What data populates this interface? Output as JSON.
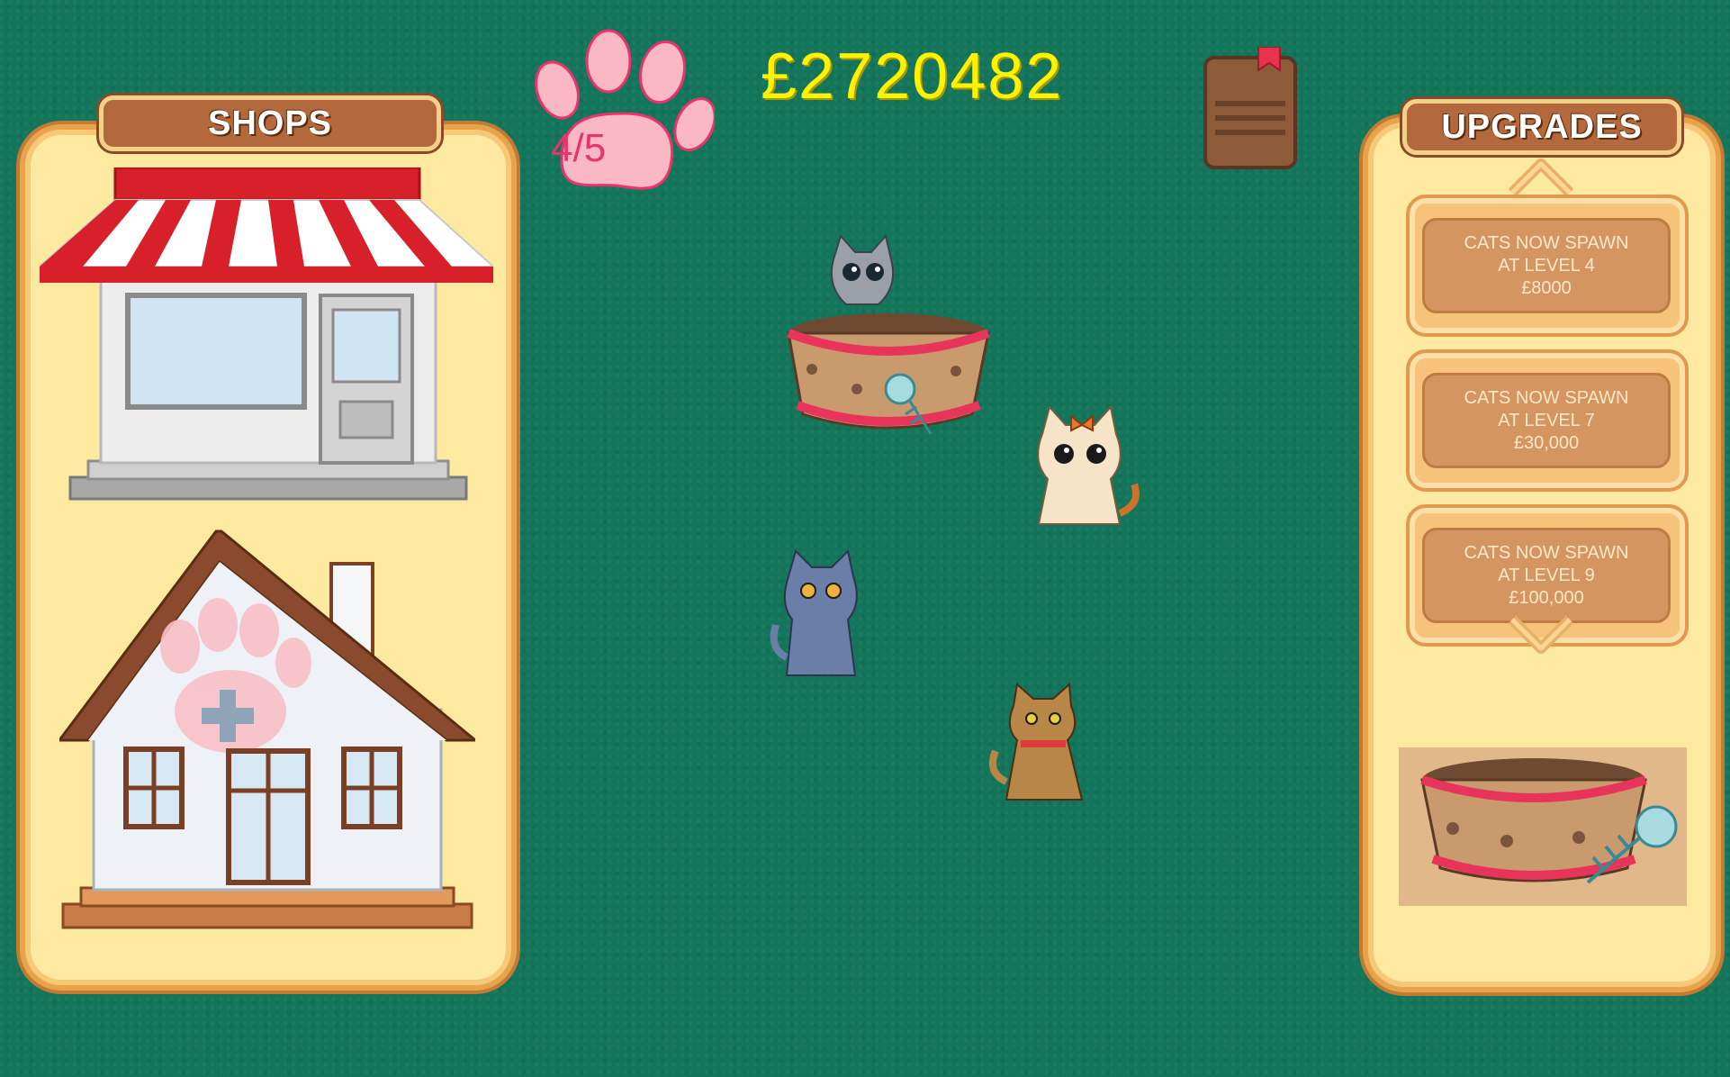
{
  "header": {
    "money": "£2720482",
    "cat_capacity": "4/5"
  },
  "shops": {
    "title": "SHOPS",
    "items": [
      {
        "name": "food-shop"
      },
      {
        "name": "vet-clinic"
      }
    ]
  },
  "upgrades": {
    "title": "UPGRADES",
    "items": [
      {
        "line1": "CATS NOW SPAWN",
        "line2": "AT LEVEL 4",
        "price": "£8000"
      },
      {
        "line1": "CATS NOW SPAWN",
        "line2": "AT LEVEL 7",
        "price": "£30,000"
      },
      {
        "line1": "CATS NOW SPAWN",
        "line2": "AT LEVEL 9",
        "price": "£100,000"
      }
    ]
  },
  "icons": {
    "paw": "paw-icon",
    "book": "book-icon",
    "up": "chevron-up-icon",
    "down": "chevron-down-icon"
  },
  "colors": {
    "background": "#13755a",
    "money": "#fff200",
    "paw": "#f9b8c4"
  }
}
